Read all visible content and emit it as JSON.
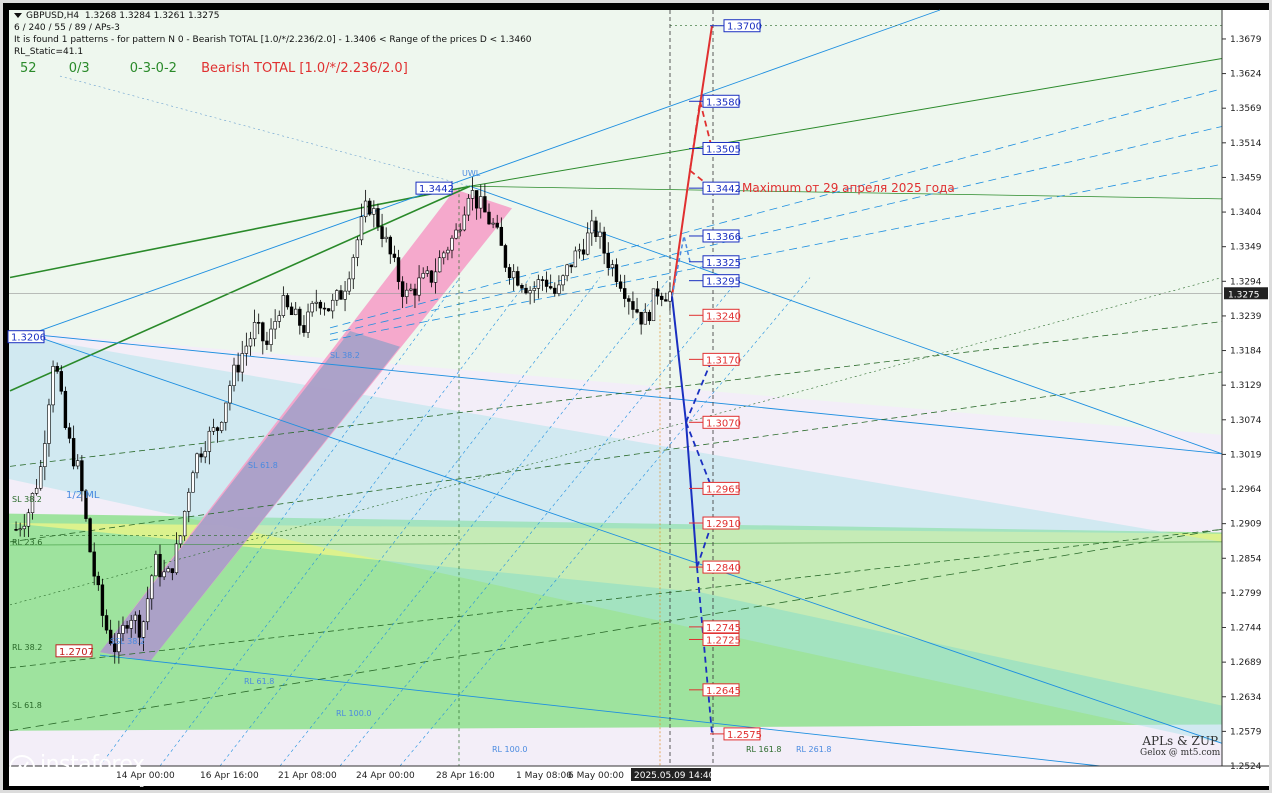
{
  "header": {
    "symbol": "GBPUSD,H4",
    "ohlc": "1.3268 1.3284 1.3261 1.3275",
    "line2": "6 / 240 / 55 / 89 / APs-3",
    "line3": "It is found 1 patterns  -  for pattern N 0 - Bearish TOTAL [1.0/*/2.236/2.0] - 1.3406 < Range of the prices D < 1.3460",
    "line4": "RL_Static=41.1"
  },
  "status": {
    "count": "52",
    "ratio": "0/3",
    "sequence": "0-3-0-2",
    "pattern": "Bearish TOTAL [1.0/*/2.236/2.0]"
  },
  "annotation": "Maximum от 29 апреля 2025 года",
  "colors": {
    "bullish_candle": "#ffffff",
    "bearish_candle": "#000000",
    "target_up": "#e03030",
    "target_down": "#1a2fc0",
    "blue_channel": "#1e8fe0",
    "green_channel": "#2a8a2a",
    "pink_band": "#f5a0c8",
    "cyan_zone": "#a8e2e8",
    "green_zone": "#8ee08e",
    "yellow_zone": "#e6f58a"
  },
  "chart_data": {
    "type": "candlestick",
    "title": "GBPUSD,H4",
    "ylim": [
      1.2524,
      1.3725
    ],
    "y_ticks": [
      "1.3679",
      "1.3624",
      "1.3569",
      "1.3514",
      "1.3459",
      "1.3404",
      "1.3349",
      "1.3294",
      "1.3239",
      "1.3184",
      "1.3129",
      "1.3074",
      "1.3019",
      "1.2964",
      "1.2909",
      "1.2854",
      "1.2799",
      "1.2744",
      "1.2689",
      "1.2634",
      "1.2579",
      "1.2524"
    ],
    "current_price": "1.3275",
    "x_ticks": [
      "14 Apr 00:00",
      "14 Apr 00:00",
      "16 Apr 16:00",
      "21 Apr 08:00",
      "24 Apr 00:00",
      "28 Apr 16:00",
      "1 May 08:00",
      "6 May 00:00"
    ],
    "x_cursor_label": "2025.05.09 14:40",
    "close_path": [
      1.29,
      1.293,
      1.3,
      1.318,
      1.305,
      1.299,
      1.285,
      1.275,
      1.2707,
      1.277,
      1.274,
      1.285,
      1.282,
      1.288,
      1.3,
      1.304,
      1.306,
      1.313,
      1.318,
      1.322,
      1.319,
      1.326,
      1.3238,
      1.322,
      1.327,
      1.325,
      1.328,
      1.335,
      1.342,
      1.338,
      1.332,
      1.327,
      1.329,
      1.33,
      1.334,
      1.337,
      1.3442,
      1.341,
      1.338,
      1.332,
      1.33,
      1.328,
      1.33,
      1.327,
      1.332,
      1.335,
      1.338,
      1.333,
      1.33,
      1.326,
      1.323,
      1.328,
      1.3275
    ],
    "price_levels": [
      {
        "label": "1.3700",
        "role": "target-up"
      },
      {
        "label": "1.3580",
        "role": "target-up"
      },
      {
        "label": "1.3505",
        "role": "target-up"
      },
      {
        "label": "1.3442",
        "role": "target-up"
      },
      {
        "label": "1.3366",
        "role": "target-up"
      },
      {
        "label": "1.3325",
        "role": "target-up"
      },
      {
        "label": "1.3295",
        "role": "target-up"
      },
      {
        "label": "1.3240",
        "role": "target-down"
      },
      {
        "label": "1.3170",
        "role": "target-down"
      },
      {
        "label": "1.3070",
        "role": "target-down"
      },
      {
        "label": "1.2965",
        "role": "target-down"
      },
      {
        "label": "1.2910",
        "role": "target-down"
      },
      {
        "label": "1.2840",
        "role": "target-down"
      },
      {
        "label": "1.2745",
        "role": "target-down"
      },
      {
        "label": "1.2725",
        "role": "target-down"
      },
      {
        "label": "1.2645",
        "role": "target-down"
      },
      {
        "label": "1.2575",
        "role": "target-down"
      }
    ],
    "swing_labels": [
      {
        "label": "1.3206",
        "role": "swing"
      },
      {
        "label": "1.3442",
        "role": "swing"
      },
      {
        "label": "1.2707",
        "role": "swing"
      }
    ],
    "line_labels": [
      "UWL",
      "1/2 ML",
      "SL 38.2",
      "SL 61.8",
      "SL 38.2",
      "SL 61.8",
      "RL 38.2",
      "RL 61.8",
      "RL 100.0",
      "RL 161.8",
      "RL 100.0",
      "RL 261.8",
      "RL 23.6",
      "SSL 38.2"
    ]
  },
  "logo": {
    "name": "instaforex",
    "tagline": "Instant Forex Trading"
  },
  "brand": {
    "line1": "APLs & ZUP",
    "line2": "Gelox @ mt5.com"
  }
}
